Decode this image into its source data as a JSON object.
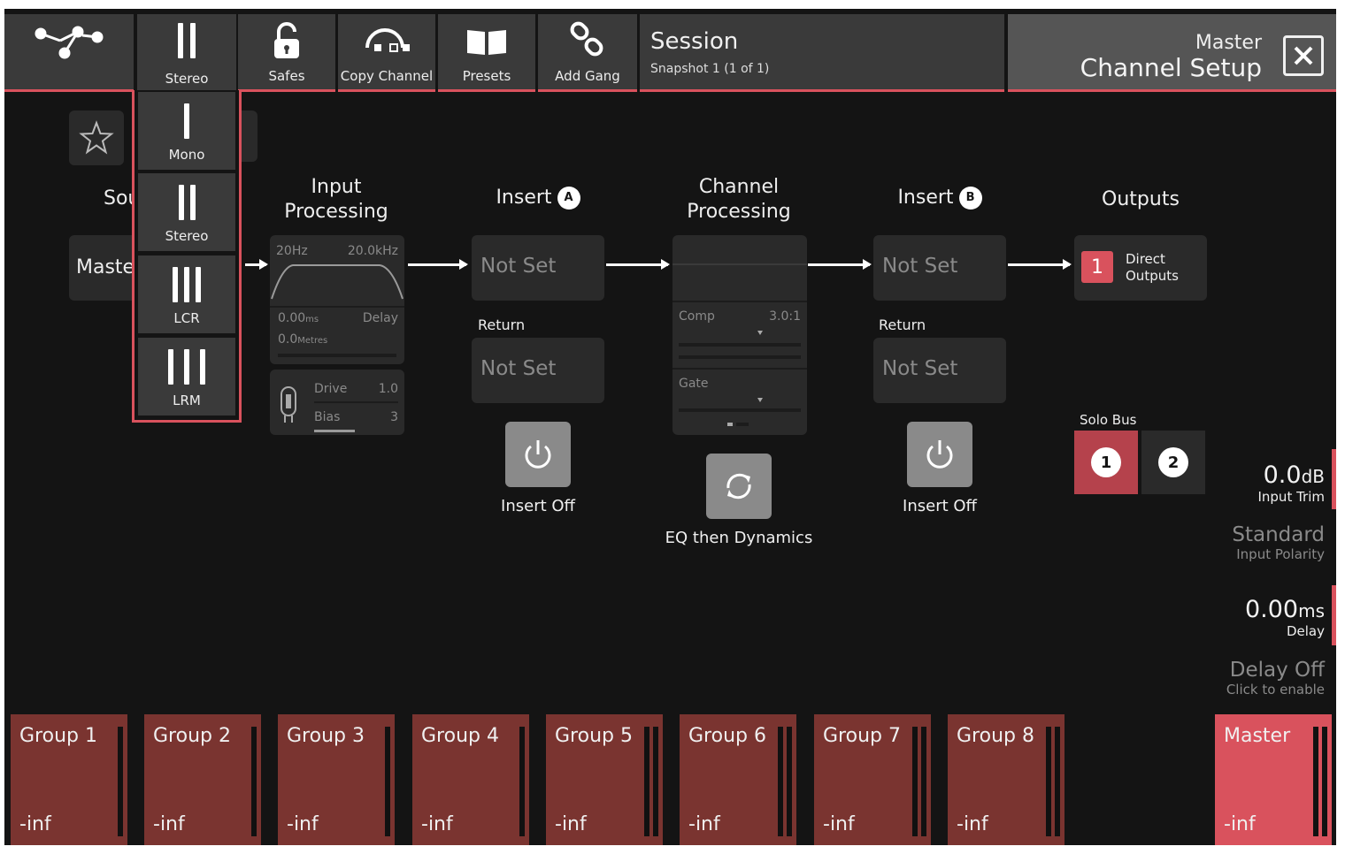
{
  "toolbar": {
    "buttons": [
      {
        "label": "",
        "icon": "routing-icon"
      },
      {
        "label": "Stereo",
        "icon": "stereo-icon"
      },
      {
        "label": "Safes",
        "icon": "lock-icon"
      },
      {
        "label": "Copy Channel",
        "icon": "copy-channel-icon"
      },
      {
        "label": "Presets",
        "icon": "presets-book-icon"
      },
      {
        "label": "Add Gang",
        "icon": "link-icon"
      }
    ],
    "session_title": "Session",
    "session_sub": "Snapshot 1 (1 of 1)",
    "master_label": "Master",
    "page_title": "Channel Setup"
  },
  "dropdown": {
    "items": [
      {
        "label": "Mono"
      },
      {
        "label": "Stereo"
      },
      {
        "label": "LCR"
      },
      {
        "label": "LRM"
      }
    ]
  },
  "source": {
    "label": "Sou",
    "value": "Maste"
  },
  "input_processing": {
    "title_1": "Input",
    "title_2": "Processing",
    "hpf": "20Hz",
    "lpf": "20.0kHz",
    "delay_ms": "0.00",
    "delay_unit": "ms",
    "delay_label": "Delay",
    "delay_m": "0.0",
    "delay_m_unit": "Metres",
    "drive_label": "Drive",
    "drive_value": "1.0",
    "bias_label": "Bias",
    "bias_value": "3"
  },
  "insert_a": {
    "title": "Insert",
    "badge": "A",
    "send": "Not Set",
    "return_label": "Return",
    "return": "Not Set",
    "state": "Insert Off"
  },
  "channel_processing": {
    "title_1": "Channel",
    "title_2": "Processing",
    "comp_label": "Comp",
    "comp_value": "3.0:1",
    "gate_label": "Gate",
    "order": "EQ then Dynamics"
  },
  "insert_b": {
    "title": "Insert",
    "badge": "B",
    "send": "Not Set",
    "return_label": "Return",
    "return": "Not Set",
    "state": "Insert Off"
  },
  "outputs": {
    "title": "Outputs",
    "num": "1",
    "text_1": "Direct",
    "text_2": "Outputs",
    "solo_label": "Solo Bus",
    "solo_1": "1",
    "solo_2": "2"
  },
  "right_panel": {
    "input_trim": "0.0",
    "input_trim_unit": "dB",
    "input_trim_label": "Input Trim",
    "polarity": "Standard",
    "polarity_label": "Input Polarity",
    "delay": "0.00",
    "delay_unit": "ms",
    "delay_label": "Delay",
    "delay_state": "Delay Off",
    "delay_hint": "Click to enable"
  },
  "strips": [
    {
      "name": "Group 1",
      "value": "-inf"
    },
    {
      "name": "Group 2",
      "value": "-inf"
    },
    {
      "name": "Group 3",
      "value": "-inf"
    },
    {
      "name": "Group 4",
      "value": "-inf"
    },
    {
      "name": "Group 5",
      "value": "-inf"
    },
    {
      "name": "Group 6",
      "value": "-inf"
    },
    {
      "name": "Group 7",
      "value": "-inf"
    },
    {
      "name": "Group 8",
      "value": "-inf"
    },
    {
      "name": "Master",
      "value": "-inf"
    }
  ],
  "colors": {
    "accent": "#d9525d",
    "group_strip": "#7a3430",
    "panel": "#2a2a2a",
    "background": "#141414"
  }
}
